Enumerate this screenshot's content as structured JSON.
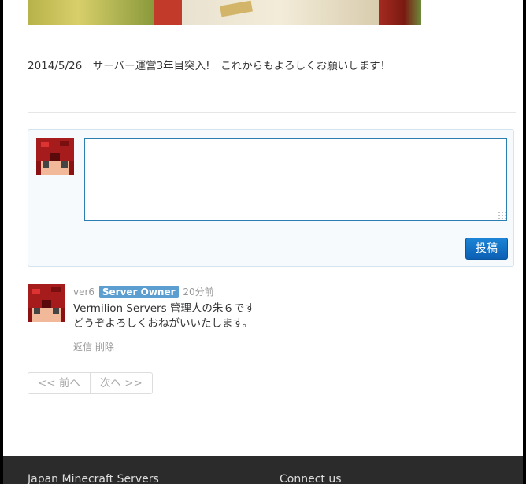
{
  "news": {
    "text": "2014/5/26　サーバー運営3年目突入!　これからもよろしくお願いします！"
  },
  "comment_form": {
    "textarea_value": "",
    "post_label": "投稿"
  },
  "comment": {
    "user": "ver6",
    "badge": "Server Owner",
    "time": "20分前",
    "line1": "Vermilion Servers 管理人の朱６です",
    "line2": "どうぞよろしくおねがいいたします。",
    "reply_label": "返信",
    "delete_label": "削除"
  },
  "pager": {
    "prev_label": "<< 前へ",
    "next_label": "次へ >>"
  },
  "footer": {
    "col1_title": "Japan Minecraft Servers",
    "col2_title": "Connect us"
  },
  "colors": {
    "accent": "#0b5fb3",
    "badge": "#5c9ed0",
    "footer_bg": "#2b2b2b"
  }
}
